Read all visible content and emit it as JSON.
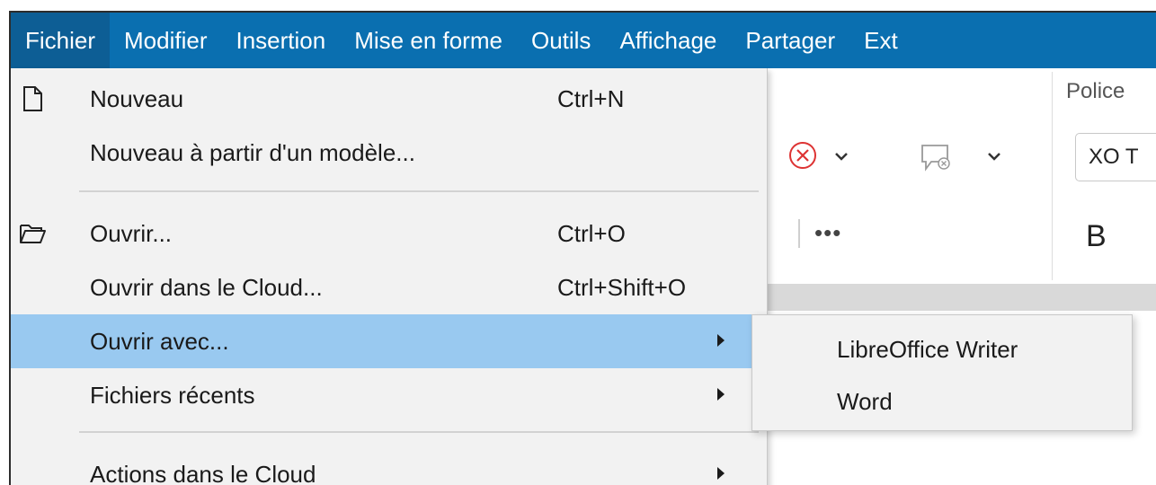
{
  "menubar": {
    "items": [
      {
        "label": "Fichier"
      },
      {
        "label": "Modifier"
      },
      {
        "label": "Insertion"
      },
      {
        "label": "Mise en forme"
      },
      {
        "label": "Outils"
      },
      {
        "label": "Affichage"
      },
      {
        "label": "Partager"
      },
      {
        "label": "Ext"
      }
    ],
    "active_item": "Fichier"
  },
  "toolbar": {
    "police_label": "Police",
    "font_value": "XO T",
    "bold_label": "B",
    "more_label": "•••",
    "icons": [
      "reject-change-icon",
      "chevron-down-icon",
      "comment-delete-icon",
      "chevron-down-icon",
      "more-icon"
    ]
  },
  "file_menu": {
    "items": [
      {
        "label": "Nouveau",
        "shortcut": "Ctrl+N",
        "icon": "new-document-icon"
      },
      {
        "label": "Nouveau à partir d'un modèle...",
        "shortcut": ""
      },
      {
        "label": "Ouvrir...",
        "shortcut": "Ctrl+O",
        "icon": "open-folder-icon"
      },
      {
        "label": "Ouvrir dans le Cloud...",
        "shortcut": "Ctrl+Shift+O"
      },
      {
        "label": "Ouvrir avec...",
        "shortcut": "",
        "submenu": true,
        "highlighted": true
      },
      {
        "label": "Fichiers récents",
        "shortcut": "",
        "submenu": true
      },
      {
        "label": "Actions dans le Cloud",
        "shortcut": "",
        "submenu": true
      }
    ]
  },
  "open_with_submenu": {
    "items": [
      {
        "label": "LibreOffice Writer"
      },
      {
        "label": "Word"
      }
    ]
  },
  "colors": {
    "menubar_bg": "#0a6fb0",
    "menubar_active": "#0d5e95",
    "highlight": "#99c9f0",
    "menu_bg": "#f2f2f2"
  }
}
